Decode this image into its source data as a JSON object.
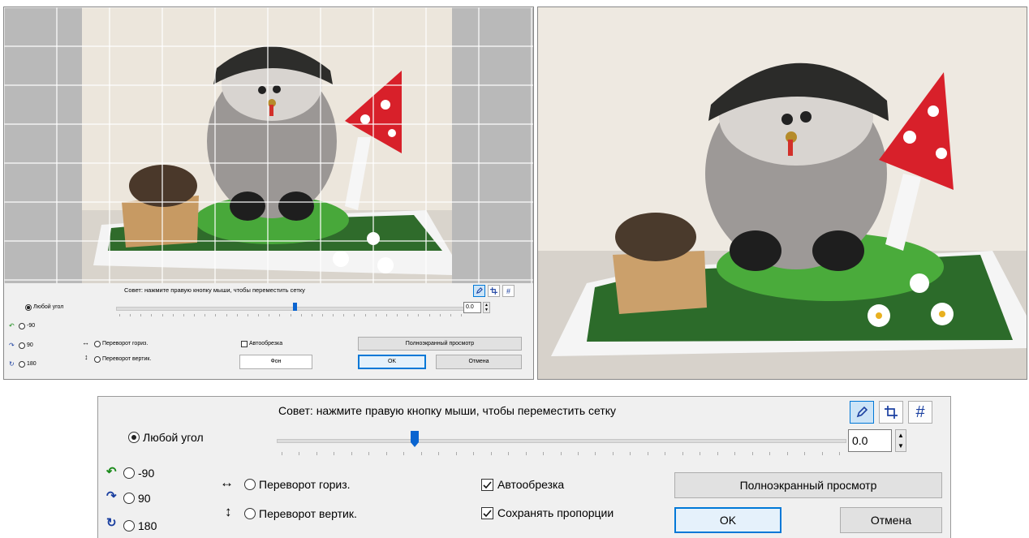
{
  "tip_text": "Совет: нажмите правую кнопку мыши, чтобы переместить сетку",
  "rotation": {
    "any_angle_label": "Любой угол",
    "minus90_label": "-90",
    "plus90_label": "90",
    "r180_label": "180",
    "selected": "any_angle"
  },
  "flip": {
    "horizontal_label": "Переворот гориз.",
    "vertical_label": "Переворот вертик.",
    "horizontal_short": "Переворот гориз.",
    "vertical_short": "Переворот вертик."
  },
  "options": {
    "autocrop_label": "Автообрезка",
    "autocrop_checked": true,
    "autocrop_checked_panel1": false,
    "keep_ratio_label": "Сохранять пропорции",
    "keep_ratio_checked": true,
    "background_label": "Фон"
  },
  "angle": {
    "value": "0.0",
    "slider_fraction": 0.5
  },
  "buttons": {
    "fullscreen_label": "Полноэкранный просмотр",
    "ok_label": "OK",
    "cancel_label": "Отмена"
  },
  "tools": {
    "draw_icon": "pencil-icon",
    "crop_icon": "crop-icon",
    "grid_icon": "grid-icon",
    "grid_glyph": "#",
    "active": "draw"
  },
  "colors": {
    "accent": "#0078d7",
    "slider_thumb": "#0a64d0",
    "dialog_bg": "#f0f0f0"
  }
}
